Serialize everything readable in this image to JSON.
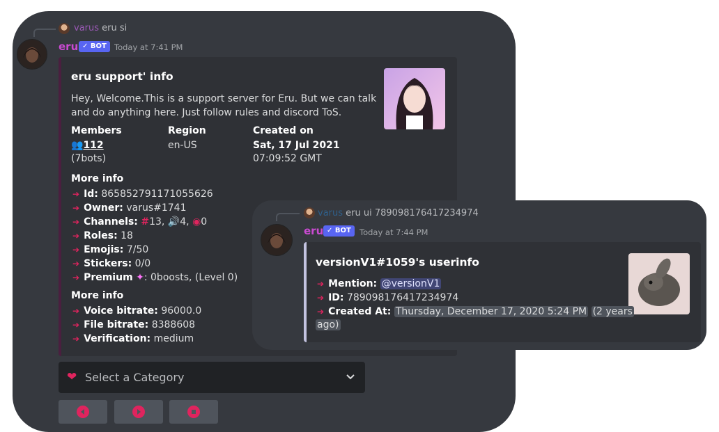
{
  "msg1": {
    "reply": {
      "user": "varus",
      "text": "eru si"
    },
    "author": "eru",
    "bot_tag": "✓ BOT",
    "timestamp": "Today at 7:41 PM",
    "embed": {
      "title": "eru support' info",
      "description": "Hey, Welcome.This is a support server for Eru. But we can talk and do anything here. Just follow rules and discord ToS.",
      "members_label": "Members",
      "members_count": "112",
      "members_bots": "(7bots)",
      "region_label": "Region",
      "region_value": "en-US",
      "created_label": "Created on",
      "created_date": "Sat, 17 Jul 2021",
      "created_time": "07:09:52 GMT",
      "more_info_1_label": "More info",
      "info_rows": [
        {
          "key": "Id:",
          "value": "865852791171055626"
        },
        {
          "key": "Owner:",
          "value": "varus#1741"
        },
        {
          "key": "Channels:",
          "text_count": "13,",
          "voice_count": "4,",
          "stage_count": "0"
        },
        {
          "key": "Roles:",
          "value": "18"
        },
        {
          "key": "Emojis:",
          "value": "7/50"
        },
        {
          "key": "Stickers:",
          "value": "0/0"
        },
        {
          "key": "Premium",
          "value": ": 0boosts, (Level 0)"
        }
      ],
      "more_info_2_label": "More info",
      "info_rows_2": [
        {
          "key": "Voice bitrate:",
          "value": "96000.0"
        },
        {
          "key": "File bitrate:",
          "value": "8388608"
        },
        {
          "key": "Verification:",
          "value": "medium"
        }
      ]
    },
    "select_placeholder": "Select a Category"
  },
  "msg2": {
    "reply": {
      "user": "varus",
      "text": "eru ui 789098176417234974"
    },
    "author": "eru",
    "bot_tag": "✓ BOT",
    "timestamp": "Today at 7:44 PM",
    "embed": {
      "title": "versionV1#1059's userinfo",
      "mention_label": "Mention:",
      "mention_value": "@versionV1",
      "id_label": "ID:",
      "id_value": "789098176417234974",
      "created_label": "Created At:",
      "created_value": "Thursday, December 17, 2020 5:24 PM",
      "relative_part1": "(2 years",
      "relative_part2": "ago)"
    }
  },
  "colors": {
    "accent_red": "#e0245e",
    "bot_badge": "#5865f2",
    "username": "#c94ad1",
    "embed1_bar": "#4a1f3f",
    "embed2_bar": "#c3c3e0"
  }
}
